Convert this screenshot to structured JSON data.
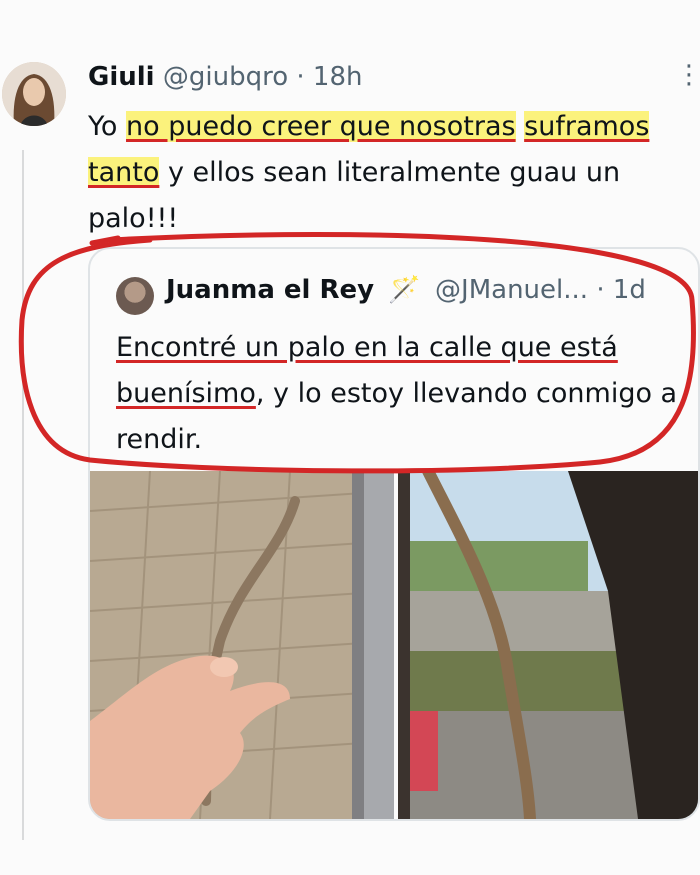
{
  "tweet": {
    "author": "Giuli",
    "handle": "@giubqro",
    "dot": "·",
    "time": "18h",
    "more": "⋮",
    "text": {
      "p1": "Yo",
      "p2": "no puedo creer que nosotras",
      "p3": "suframos tanto",
      "p4": " y ellos sean literalmente guau un palo!!!"
    }
  },
  "quote": {
    "author": "Juanma el Rey",
    "wand": "🪄",
    "handle": "@JManuel...",
    "dot": "·",
    "time": "1d",
    "text": {
      "p1": "Encontré un palo en la calle que está buenísimo",
      "p2": ", y lo estoy llevando conmigo a rendir."
    }
  },
  "colors": {
    "highlight": "#fbf27c",
    "annotation_red": "#d32626",
    "text": "#0f1419",
    "muted": "#536471"
  },
  "icons": {
    "more": "more-vertical-icon",
    "wand": "magic-wand-icon"
  }
}
